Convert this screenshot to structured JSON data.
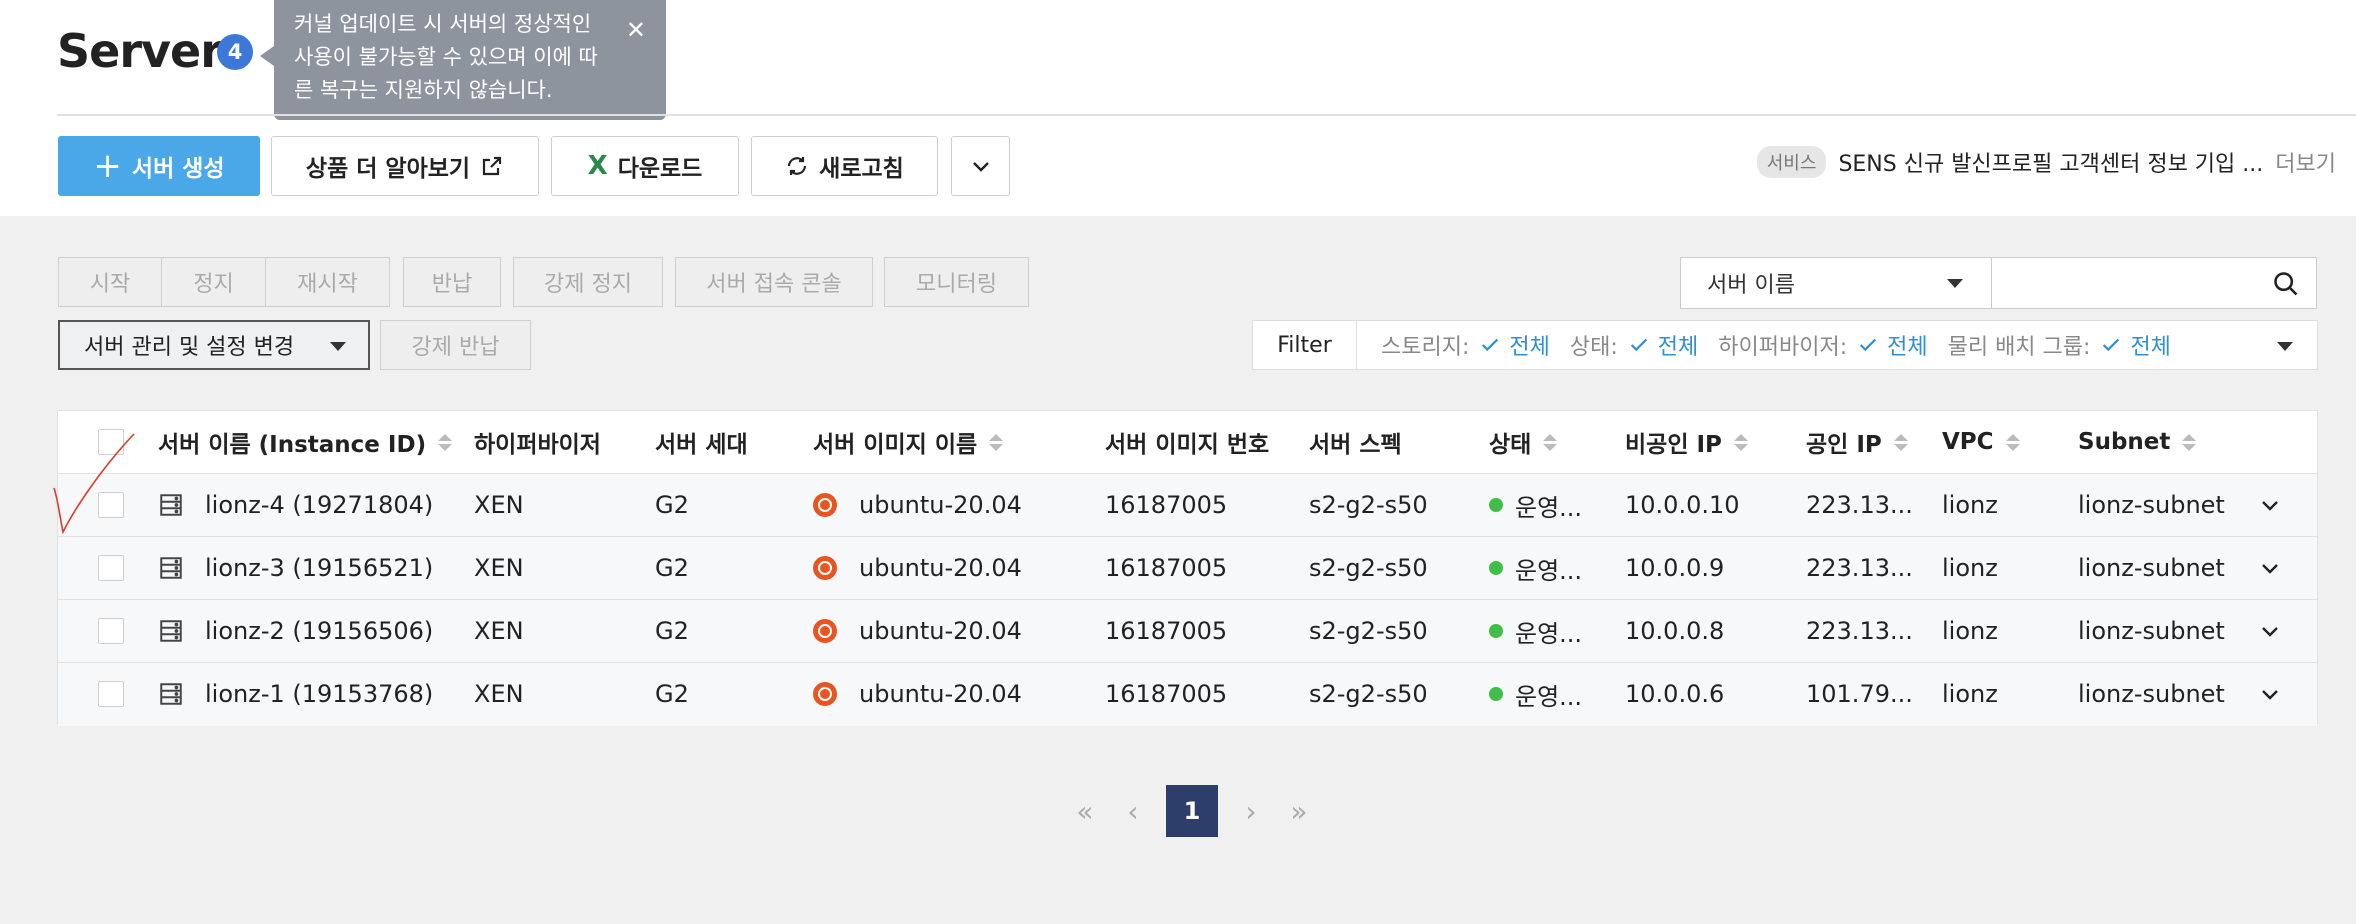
{
  "header": {
    "title": "Server",
    "count": "4",
    "tooltip_text": "커널 업데이트 시 서버의 정상적인 사용이 불가능할 수 있으며 이에 따른 복구는 지원하지 않습니다."
  },
  "toolbar": {
    "create_label": "서버 생성",
    "learn_more_label": "상품 더 알아보기",
    "download_label": "다운로드",
    "refresh_label": "새로고침"
  },
  "notice": {
    "tag": "서비스",
    "text": "SENS 신규 발신프로필 고객센터 정보 기입 ...",
    "more": "더보기"
  },
  "actions": {
    "start": "시작",
    "stop": "정지",
    "restart": "재시작",
    "return": "반납",
    "force_stop": "강제 정지",
    "console": "서버 접속 콘솔",
    "monitoring": "모니터링",
    "manage": "서버 관리 및 설정 변경",
    "force_return": "강제 반납"
  },
  "search": {
    "field_select": "서버 이름",
    "placeholder": ""
  },
  "filter": {
    "label": "Filter",
    "items": [
      {
        "name": "스토리지:",
        "value": "전체"
      },
      {
        "name": "상태:",
        "value": "전체"
      },
      {
        "name": "하이퍼바이저:",
        "value": "전체"
      },
      {
        "name": "물리 배치 그룹:",
        "value": "전체"
      }
    ]
  },
  "table": {
    "columns": [
      "서버 이름 (Instance ID)",
      "하이퍼바이저",
      "서버 세대",
      "서버 이미지 이름",
      "서버 이미지 번호",
      "서버 스펙",
      "상태",
      "비공인 IP",
      "공인 IP",
      "VPC",
      "Subnet"
    ],
    "rows": [
      {
        "name": "lionz-4 (19271804)",
        "hypervisor": "XEN",
        "gen": "G2",
        "image": "ubuntu-20.04",
        "image_no": "16187005",
        "spec": "s2-g2-s50",
        "status": "운영...",
        "private_ip": "10.0.0.10",
        "public_ip": "223.13...",
        "vpc": "lionz",
        "subnet": "lionz-subnet"
      },
      {
        "name": "lionz-3 (19156521)",
        "hypervisor": "XEN",
        "gen": "G2",
        "image": "ubuntu-20.04",
        "image_no": "16187005",
        "spec": "s2-g2-s50",
        "status": "운영...",
        "private_ip": "10.0.0.9",
        "public_ip": "223.13...",
        "vpc": "lionz",
        "subnet": "lionz-subnet"
      },
      {
        "name": "lionz-2 (19156506)",
        "hypervisor": "XEN",
        "gen": "G2",
        "image": "ubuntu-20.04",
        "image_no": "16187005",
        "spec": "s2-g2-s50",
        "status": "운영...",
        "private_ip": "10.0.0.8",
        "public_ip": "223.13...",
        "vpc": "lionz",
        "subnet": "lionz-subnet"
      },
      {
        "name": "lionz-1 (19153768)",
        "hypervisor": "XEN",
        "gen": "G2",
        "image": "ubuntu-20.04",
        "image_no": "16187005",
        "spec": "s2-g2-s50",
        "status": "운영...",
        "private_ip": "10.0.0.6",
        "public_ip": "101.79...",
        "vpc": "lionz",
        "subnet": "lionz-subnet"
      }
    ]
  },
  "pagination": {
    "current_page": "1"
  },
  "colors": {
    "primary": "#4aa8e8",
    "badge": "#3b78d8",
    "filter_value": "#2d8fd5",
    "status_running": "#3fbf4a",
    "pager_active": "#2e3e6b"
  }
}
